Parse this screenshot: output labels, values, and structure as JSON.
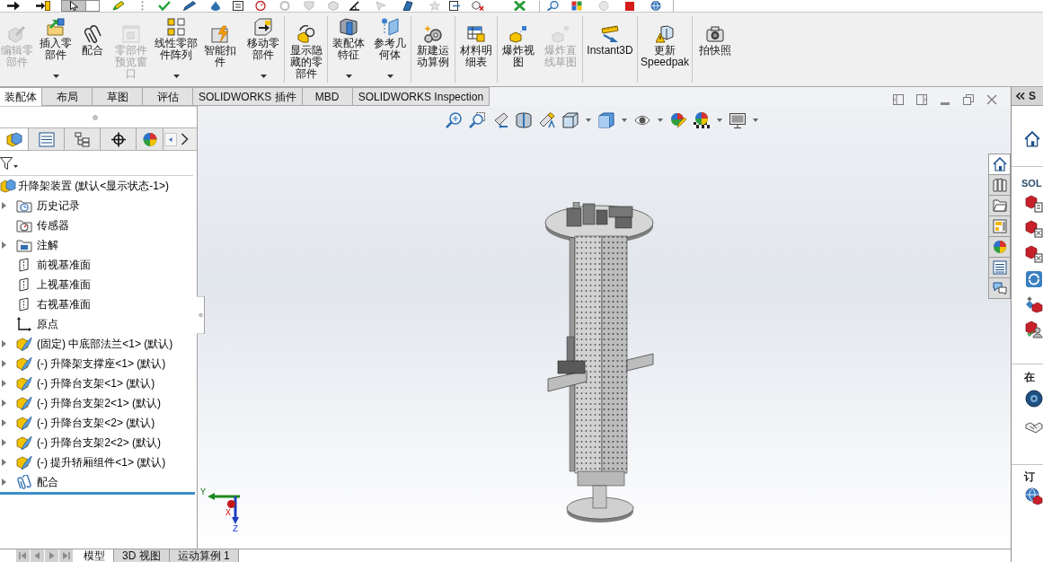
{
  "quick_toolbar": {
    "select_pressed": true
  },
  "command_groups": [
    [
      {
        "kind": "edit_component",
        "label": "编辑零部件",
        "disabled": true,
        "dropdown": false
      },
      {
        "kind": "insert_components",
        "label": "插入零部件",
        "disabled": false,
        "dropdown": true
      },
      {
        "kind": "mate",
        "label": "配合",
        "disabled": false,
        "dropdown": false
      },
      {
        "kind": "component_preview",
        "label": "零部件预览窗口",
        "disabled": true,
        "dropdown": false
      },
      {
        "kind": "linear_pattern",
        "label": "线性零部件阵列",
        "disabled": false,
        "dropdown": true
      },
      {
        "kind": "smart_fasteners",
        "label": "智能扣件",
        "disabled": false,
        "dropdown": false
      },
      {
        "kind": "move_component",
        "label": "移动零部件",
        "disabled": false,
        "dropdown": true
      }
    ],
    [
      {
        "kind": "show_hidden",
        "label": "显示隐藏的零部件",
        "disabled": false,
        "dropdown": false
      }
    ],
    [
      {
        "kind": "assembly_features",
        "label": "装配体特征",
        "disabled": false,
        "dropdown": true
      },
      {
        "kind": "reference_geometry",
        "label": "参考几何体",
        "disabled": false,
        "dropdown": true
      }
    ],
    [
      {
        "kind": "motion_study",
        "label": "新建运动算例",
        "disabled": false,
        "dropdown": false
      }
    ],
    [
      {
        "kind": "bom",
        "label": "材料明细表",
        "disabled": false,
        "dropdown": false
      }
    ],
    [
      {
        "kind": "exploded_view",
        "label": "爆炸视图",
        "disabled": false,
        "dropdown": false
      },
      {
        "kind": "explode_line",
        "label": "爆炸直线草图",
        "disabled": true,
        "dropdown": false
      }
    ],
    [
      {
        "kind": "instant3d",
        "label": "Instant3D",
        "disabled": false,
        "dropdown": false
      }
    ],
    [
      {
        "kind": "speedpak",
        "label": "更新Speedpak",
        "disabled": false,
        "dropdown": false
      }
    ],
    [
      {
        "kind": "snapshot",
        "label": "拍快照",
        "disabled": false,
        "dropdown": false
      }
    ]
  ],
  "command_tabs": [
    {
      "label": "装配体",
      "selected": true
    },
    {
      "label": "布局",
      "selected": false
    },
    {
      "label": "草图",
      "selected": false
    },
    {
      "label": "评估",
      "selected": false
    },
    {
      "label": "SOLIDWORKS 插件",
      "selected": false
    },
    {
      "label": "MBD",
      "selected": false
    },
    {
      "label": "SOLIDWORKS Inspection",
      "selected": false
    }
  ],
  "feature_manager": {
    "tabs": [
      {
        "kind": "feature_tree",
        "selected": true
      },
      {
        "kind": "property",
        "selected": false
      },
      {
        "kind": "configuration",
        "selected": false
      },
      {
        "kind": "dimxpert",
        "selected": false
      },
      {
        "kind": "display",
        "selected": false
      }
    ],
    "tree": {
      "kind": "assembly",
      "label": "升降架装置 (默认<显示状态-1>)",
      "children": [
        {
          "kind": "history",
          "label": "历史记录",
          "collapsed": true
        },
        {
          "kind": "sensors",
          "label": "传感器",
          "collapsed": false
        },
        {
          "kind": "annotations",
          "label": "注解",
          "collapsed": true
        },
        {
          "kind": "plane",
          "label": "前视基准面",
          "collapsed": false
        },
        {
          "kind": "plane",
          "label": "上视基准面",
          "collapsed": false
        },
        {
          "kind": "plane",
          "label": "右视基准面",
          "collapsed": false
        },
        {
          "kind": "origin",
          "label": "原点",
          "collapsed": false
        },
        {
          "kind": "part",
          "label": "(固定) 中底部法兰<1> (默认)",
          "collapsed": true
        },
        {
          "kind": "part",
          "label": "(-) 升降架支撑座<1> (默认)",
          "collapsed": true
        },
        {
          "kind": "part",
          "label": "(-) 升降台支架<1> (默认)",
          "collapsed": true
        },
        {
          "kind": "part",
          "label": "(-) 升降台支架2<1> (默认)",
          "collapsed": true
        },
        {
          "kind": "part",
          "label": "(-) 升降台支架<2> (默认)",
          "collapsed": true
        },
        {
          "kind": "part",
          "label": "(-) 升降台支架2<2> (默认)",
          "collapsed": true
        },
        {
          "kind": "part",
          "label": "(-) 提升轿厢组件<1> (默认)",
          "collapsed": true
        },
        {
          "kind": "mates",
          "label": "配合",
          "collapsed": true
        }
      ]
    }
  },
  "graphics_area": {
    "triad": {
      "y_label": "Y",
      "x_label": "X",
      "z_label": "Z"
    }
  },
  "bottom_tabs": [
    {
      "label": "模型",
      "selected": true
    },
    {
      "label": "3D 视图",
      "selected": false
    },
    {
      "label": "运动算例 1",
      "selected": false
    }
  ],
  "task_pane": {
    "header": "S",
    "tabs": [
      {
        "kind": "home",
        "selected": true
      },
      {
        "kind": "library",
        "selected": false
      },
      {
        "kind": "explorer",
        "selected": false
      },
      {
        "kind": "view_palette",
        "selected": false
      },
      {
        "kind": "appearances",
        "selected": false
      },
      {
        "kind": "custom_properties",
        "selected": false
      },
      {
        "kind": "forum",
        "selected": false
      }
    ],
    "sections": [
      {
        "title": "SOL"
      },
      {
        "title": "在"
      },
      {
        "title": "订"
      }
    ]
  }
}
